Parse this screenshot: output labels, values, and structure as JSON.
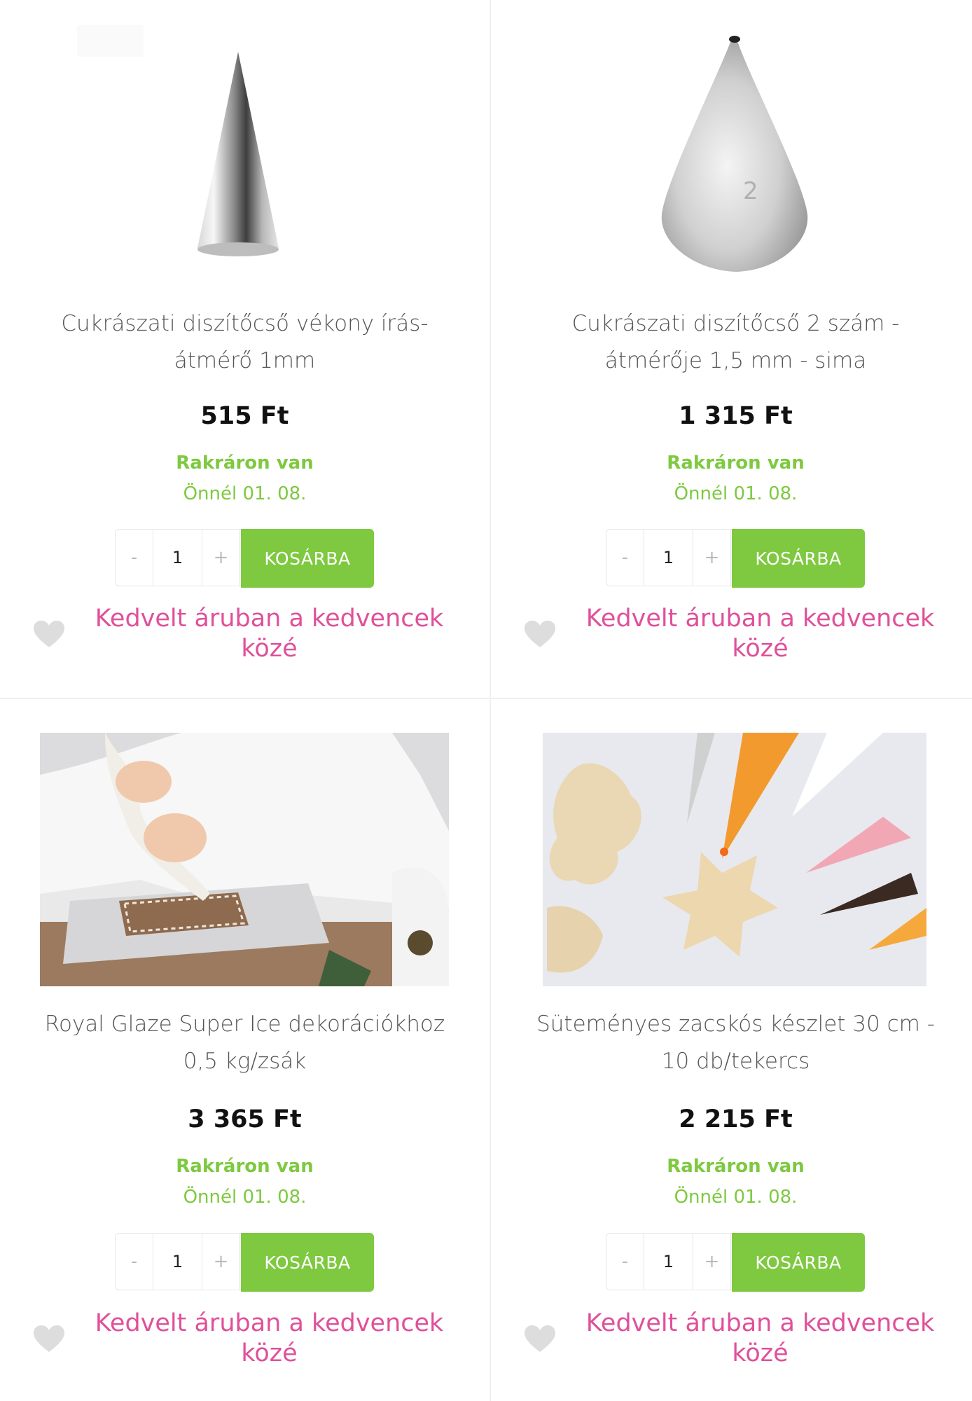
{
  "products": [
    {
      "title": "Cukrászati diszítőcső vékony írás-átmérő 1mm",
      "price": "515 Ft",
      "stock": "Rakráron van",
      "delivery": "Önnél 01. 08.",
      "qty_minus": "-",
      "qty_value": "1",
      "qty_plus": "+",
      "cart_label": "KOSÁRBA",
      "fav_label": "Kedvelt áruban a kedvencek közé",
      "image": "thin-piping-tip"
    },
    {
      "title": "Cukrászati diszítőcső 2 szám - átmérője 1,5 mm - sima",
      "price": "1 315 Ft",
      "stock": "Rakráron van",
      "delivery": "Önnél 01. 08.",
      "qty_minus": "-",
      "qty_value": "1",
      "qty_plus": "+",
      "cart_label": "KOSÁRBA",
      "fav_label": "Kedvelt áruban a kedvencek közé",
      "image": "piping-tip-no2",
      "image_engraving": "2"
    },
    {
      "title": "Royal Glaze Super Ice dekorációkhoz 0,5 kg/zsák",
      "price": "3 365 Ft",
      "stock": "Rakráron van",
      "delivery": "Önnél 01. 08.",
      "qty_minus": "-",
      "qty_value": "1",
      "qty_plus": "+",
      "cart_label": "KOSÁRBA",
      "fav_label": "Kedvelt áruban a kedvencek közé",
      "image": "gingerbread-icing-photo"
    },
    {
      "title": "Süteményes zacskós készlet 30 cm - 10 db/tekercs",
      "price": "2 215 Ft",
      "stock": "Rakráron van",
      "delivery": "Önnél 01. 08.",
      "qty_minus": "-",
      "qty_value": "1",
      "qty_plus": "+",
      "cart_label": "KOSÁRBA",
      "fav_label": "Kedvelt áruban a kedvencek közé",
      "image": "cookies-piping-bags-photo"
    }
  ],
  "colors": {
    "accent_green": "#7ec940",
    "favorite_pink": "#e0509a",
    "heart_grey": "#dddddd"
  }
}
